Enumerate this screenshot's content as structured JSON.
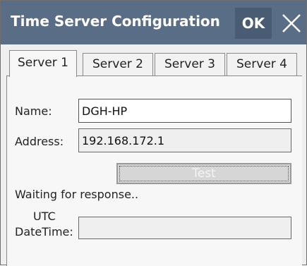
{
  "window": {
    "title": "Time Server Configuration",
    "ok_label": "OK"
  },
  "tabs": [
    {
      "label": "Server 1",
      "active": true
    },
    {
      "label": "Server 2",
      "active": false
    },
    {
      "label": "Server 3",
      "active": false
    },
    {
      "label": "Server 4",
      "active": false
    }
  ],
  "form": {
    "name_label": "Name:",
    "name_value": "DGH-HP",
    "address_label": "Address:",
    "address_value": "192.168.172.1",
    "test_label": "Test",
    "status_text": "Waiting for response..",
    "utc_label_line1": "UTC",
    "utc_label_line2": "DateTime:",
    "utc_value": ""
  },
  "colors": {
    "titlebar": "#5a6d86",
    "ok_button": "#4a5c73",
    "panel": "#f7f7f7"
  }
}
